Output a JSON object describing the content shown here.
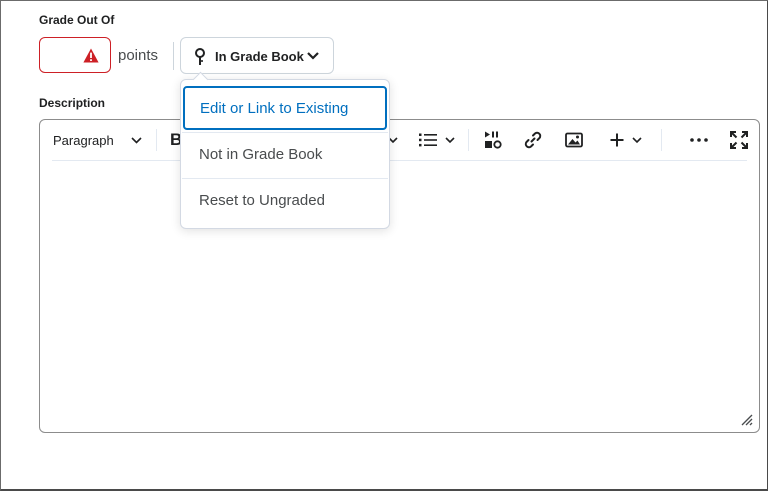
{
  "grade": {
    "label": "Grade Out Of",
    "value": "",
    "units": "points",
    "status": "error",
    "button_label": "In Grade Book"
  },
  "description": {
    "label": "Description",
    "content": ""
  },
  "toolbar": {
    "format_select": "Paragraph",
    "bold_partial": "B",
    "icons": [
      "chevron-down-icon",
      "list-icon",
      "media-icon",
      "link-icon",
      "image-icon",
      "plus-icon",
      "more-icon",
      "fullscreen-icon"
    ]
  },
  "dropdown": {
    "items": [
      {
        "label": "Edit or Link to Existing",
        "focused": true
      },
      {
        "label": "Not in Grade Book",
        "focused": false
      },
      {
        "label": "Reset to Ungraded",
        "focused": false
      }
    ]
  },
  "colors": {
    "error": "#cd2026",
    "focus": "#006fbf",
    "border": "#cdd5dc"
  }
}
